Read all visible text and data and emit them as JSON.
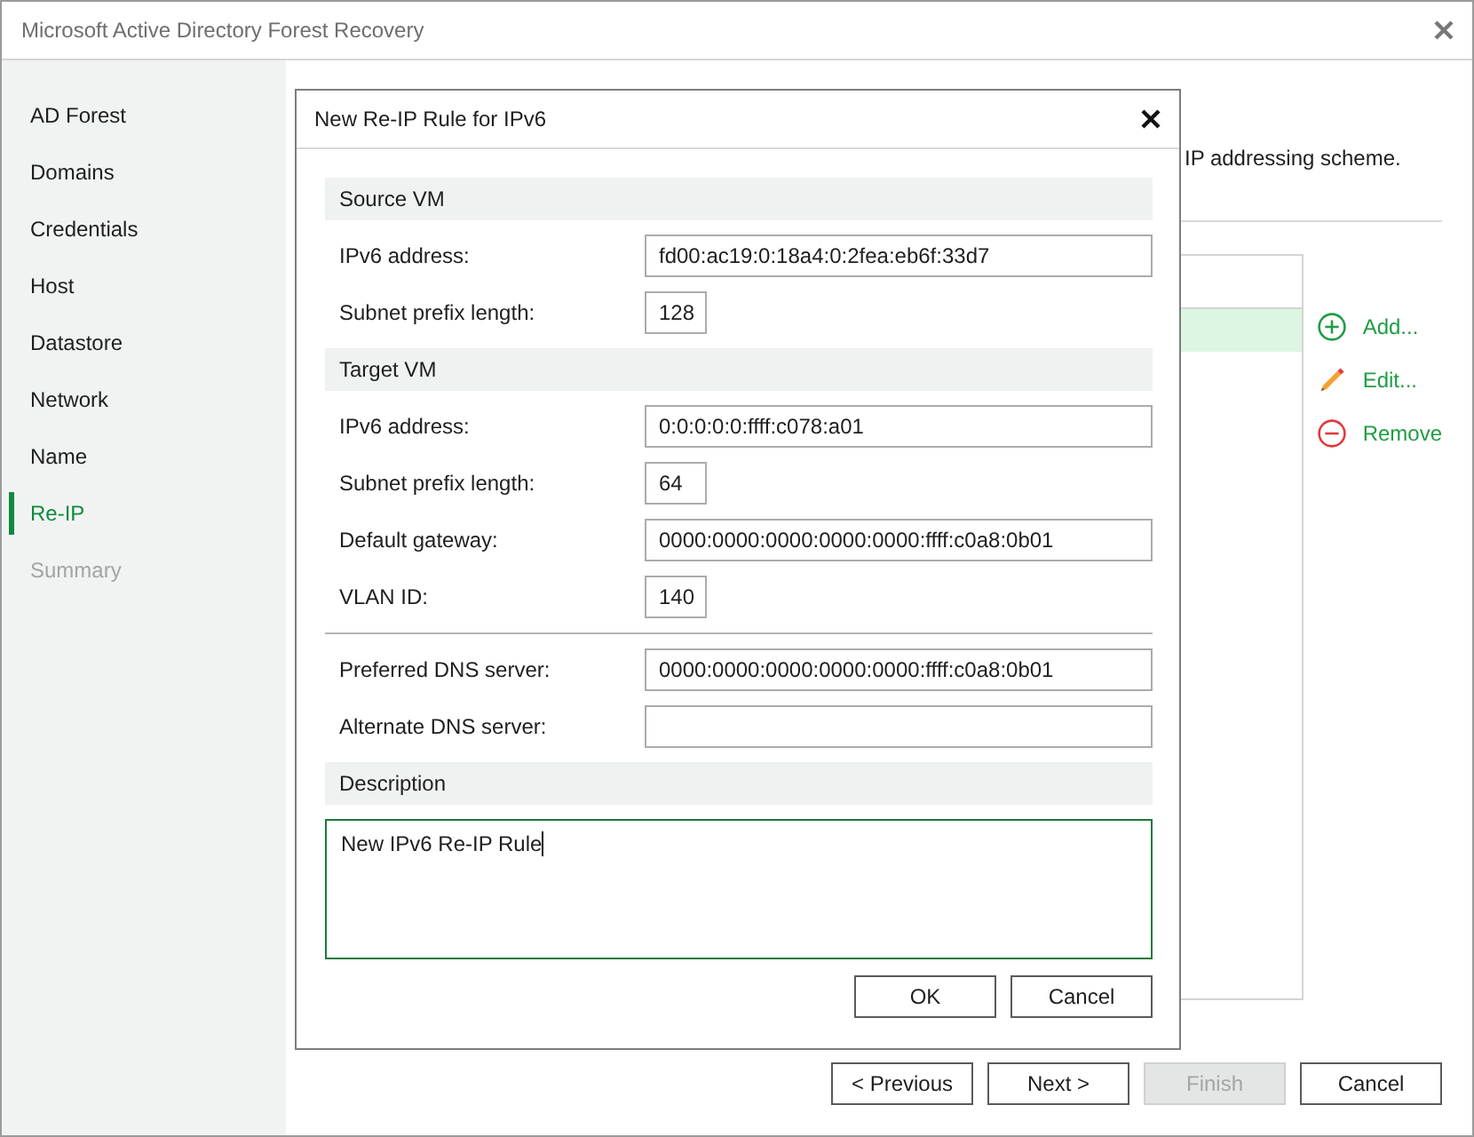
{
  "window": {
    "title": "Microsoft Active Directory Forest Recovery"
  },
  "sidebar": {
    "items": [
      {
        "label": "AD Forest",
        "selected": false,
        "disabled": false
      },
      {
        "label": "Domains",
        "selected": false,
        "disabled": false
      },
      {
        "label": "Credentials",
        "selected": false,
        "disabled": false
      },
      {
        "label": "Host",
        "selected": false,
        "disabled": false
      },
      {
        "label": "Datastore",
        "selected": false,
        "disabled": false
      },
      {
        "label": "Network",
        "selected": false,
        "disabled": false
      },
      {
        "label": "Name",
        "selected": false,
        "disabled": false
      },
      {
        "label": "Re-IP",
        "selected": true,
        "disabled": false
      },
      {
        "label": "Summary",
        "selected": false,
        "disabled": true
      }
    ]
  },
  "page": {
    "description": "IP addressing scheme."
  },
  "rules_list": {
    "rows": [
      {
        "selected": true
      }
    ]
  },
  "rule_actions": [
    {
      "kind": "add",
      "label": "Add..."
    },
    {
      "kind": "edit",
      "label": "Edit..."
    },
    {
      "kind": "remove",
      "label": "Remove"
    }
  ],
  "wizard_buttons": [
    {
      "label": "< Previous",
      "disabled": false
    },
    {
      "label": "Next >",
      "disabled": false
    },
    {
      "label": "Finish",
      "disabled": true
    },
    {
      "label": "Cancel",
      "disabled": false
    }
  ],
  "dialog": {
    "title": "New Re-IP Rule for IPv6",
    "sections": [
      {
        "kind": "group",
        "title": "Source VM",
        "fields": [
          {
            "kind": "address",
            "label": "IPv6 address:",
            "value": "fd00:ac19:0:18a4:0:2fea:eb6f:33d7"
          },
          {
            "kind": "number",
            "label": "Subnet prefix length:",
            "value": "128"
          }
        ]
      },
      {
        "kind": "group",
        "title": "Target VM",
        "fields": [
          {
            "kind": "address",
            "label": "IPv6 address:",
            "value": "0:0:0:0:0:ffff:c078:a01"
          },
          {
            "kind": "number",
            "label": "Subnet prefix length:",
            "value": "64"
          },
          {
            "kind": "address",
            "label": "Default gateway:",
            "value": "0000:0000:0000:0000:0000:ffff:c0a8:0b01"
          },
          {
            "kind": "number",
            "label": "VLAN ID:",
            "value": "140"
          }
        ]
      },
      {
        "kind": "plain",
        "fields": [
          {
            "kind": "address",
            "label": "Preferred DNS server:",
            "value": "0000:0000:0000:0000:0000:ffff:c0a8:0b01"
          },
          {
            "kind": "address",
            "label": "Alternate DNS server:"
          }
        ]
      },
      {
        "kind": "text",
        "title": "Description",
        "value": "New IPv6 Re-IP Rule",
        "focused": true
      }
    ],
    "buttons": [
      {
        "label": "OK"
      },
      {
        "label": "Cancel"
      }
    ]
  }
}
